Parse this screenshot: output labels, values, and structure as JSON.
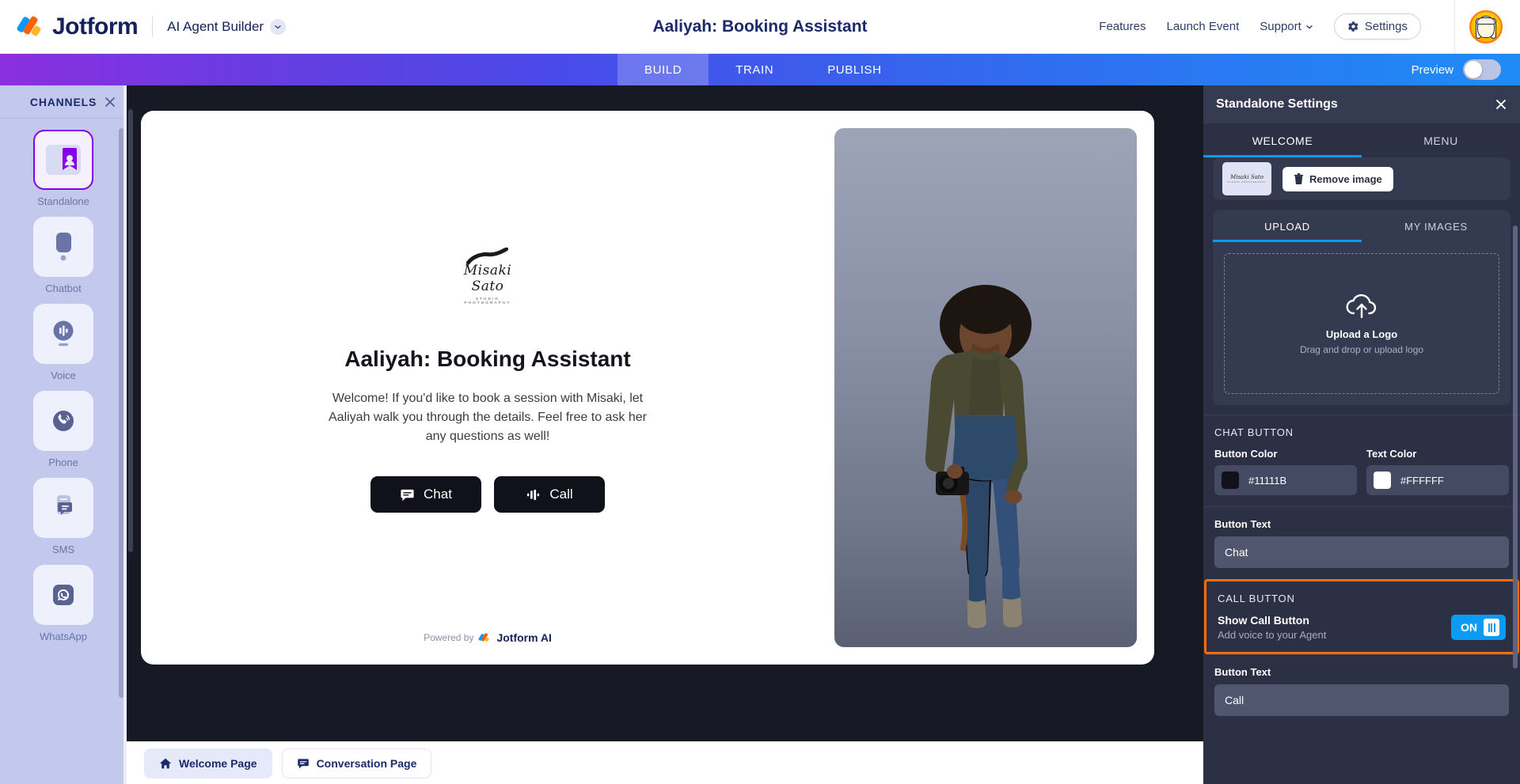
{
  "header": {
    "brand": "Jotform",
    "product": "AI Agent Builder",
    "title": "Aaliyah: Booking Assistant",
    "links": [
      {
        "label": "Features",
        "caret": false
      },
      {
        "label": "Launch Event",
        "caret": false
      },
      {
        "label": "Support",
        "caret": true
      }
    ],
    "settings_label": "Settings"
  },
  "navbar": {
    "tabs": [
      {
        "label": "BUILD",
        "active": true
      },
      {
        "label": "TRAIN",
        "active": false
      },
      {
        "label": "PUBLISH",
        "active": false
      }
    ],
    "preview_label": "Preview",
    "preview_on": false
  },
  "channels": {
    "title": "CHANNELS",
    "items": [
      {
        "label": "Standalone",
        "icon": "standalone-icon",
        "active": true
      },
      {
        "label": "Chatbot",
        "icon": "chatbot-icon",
        "active": false
      },
      {
        "label": "Voice",
        "icon": "voice-icon",
        "active": false
      },
      {
        "label": "Phone",
        "icon": "phone-icon",
        "active": false
      },
      {
        "label": "SMS",
        "icon": "sms-icon",
        "active": false
      },
      {
        "label": "WhatsApp",
        "icon": "whatsapp-icon",
        "active": false
      }
    ]
  },
  "preview": {
    "logo_script": "Misaki Sato",
    "logo_sub": "STUDIO PHOTOGRAPHY",
    "title": "Aaliyah: Booking Assistant",
    "description": "Welcome! If you'd like to book a session with Misaki, let Aaliyah walk you through the details. Feel free to ask her any questions as well!",
    "chat_button": "Chat",
    "call_button": "Call",
    "powered_by": "Powered by",
    "powered_brand": "Jotform AI"
  },
  "bottombar": {
    "tabs": [
      {
        "label": "Welcome Page",
        "icon": "home-icon",
        "active": true
      },
      {
        "label": "Conversation Page",
        "icon": "chat-icon",
        "active": false
      }
    ]
  },
  "settings": {
    "title": "Standalone Settings",
    "tabs": [
      {
        "label": "WELCOME",
        "active": true
      },
      {
        "label": "MENU",
        "active": false
      }
    ],
    "remove_image_label": "Remove image",
    "thumb_script": "Misaki Sato",
    "thumb_sub": "STUDIO PHOTOGRAPHY",
    "subtabs": [
      {
        "label": "UPLOAD",
        "active": true
      },
      {
        "label": "MY IMAGES",
        "active": false
      }
    ],
    "dropzone": {
      "title": "Upload a Logo",
      "subtitle": "Drag and drop or upload logo"
    },
    "chat_button_section": {
      "title": "CHAT BUTTON",
      "button_color_label": "Button Color",
      "button_color_value": "#11111B",
      "text_color_label": "Text Color",
      "text_color_value": "#FFFFFF",
      "button_text_label": "Button Text",
      "button_text_value": "Chat"
    },
    "call_button_section": {
      "title": "CALL BUTTON",
      "toggle_title": "Show Call Button",
      "toggle_sub": "Add voice to your Agent",
      "toggle_state": "ON",
      "button_text_label": "Button Text",
      "button_text_value": "Call"
    }
  }
}
